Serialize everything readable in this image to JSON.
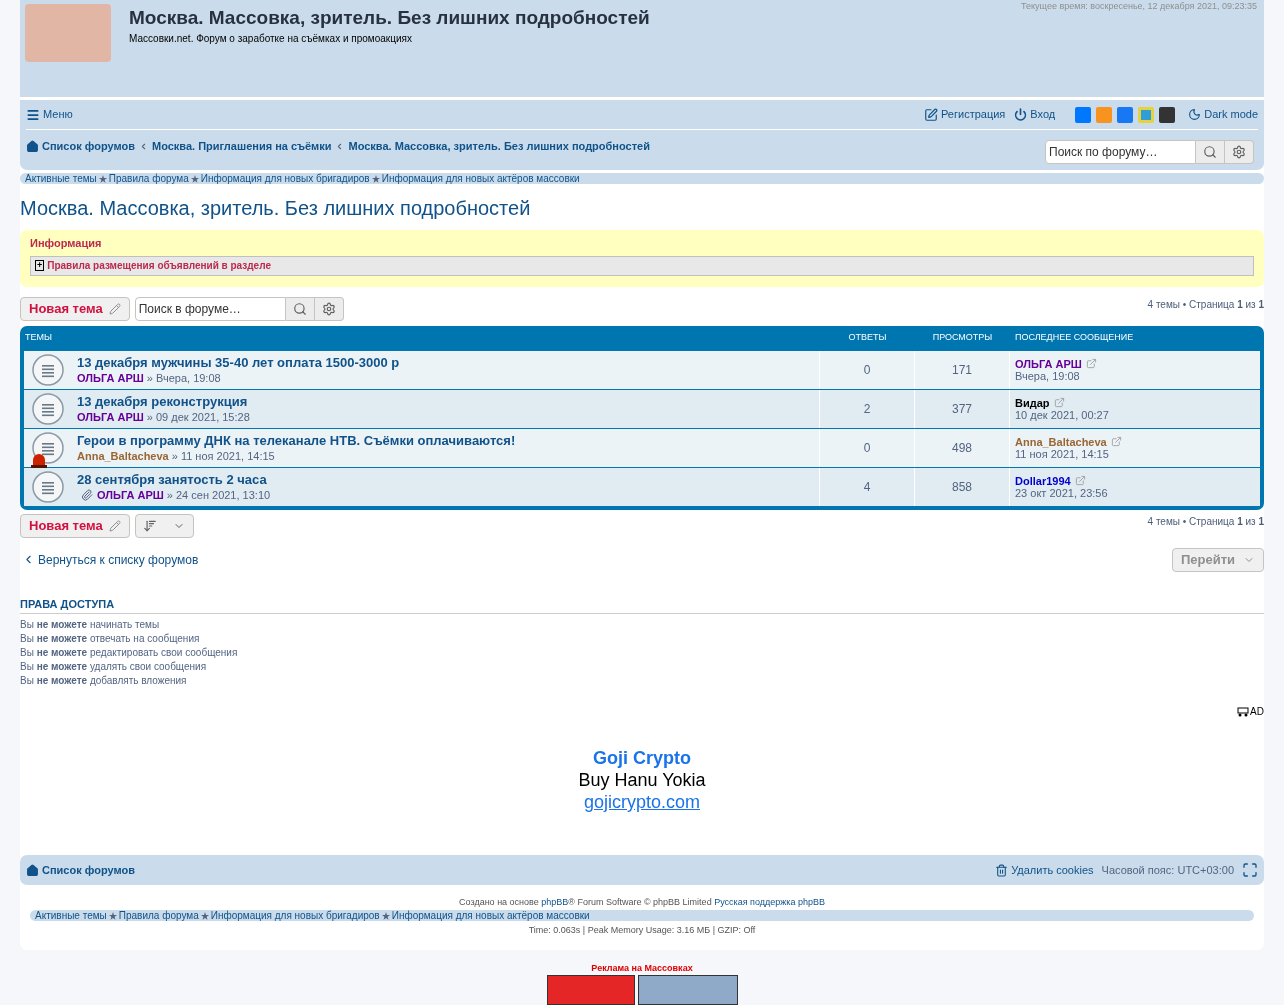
{
  "header": {
    "time": "Текущее время: воскресенье, 12 декабря 2021, 09:23:35",
    "title": "Москва. Массовка, зритель. Без лишних подробностей",
    "subtitle": "Массовки.net. Форум о заработке на съёмках и промоакциях"
  },
  "navbar": {
    "menu": "Меню",
    "register": "Регистрация",
    "login": "Вход",
    "dark_mode": "Dark mode"
  },
  "breadcrumbs": [
    "Список форумов",
    "Москва. Приглашения на съёмки",
    "Москва. Массовка, зритель. Без лишних подробностей"
  ],
  "search": {
    "placeholder": "Поиск по форуму…"
  },
  "quicklinks": [
    "Активные темы",
    "Правила форума",
    "Информация для новых бригадиров",
    "Информация для новых актёров массовки"
  ],
  "page_title": "Москва. Массовка, зритель. Без лишних подробностей",
  "info": {
    "title": "Информация",
    "toggle": "+",
    "rule": "Правила размещения объявлений в разделе"
  },
  "toolbar": {
    "new_topic": "Новая тема",
    "search_placeholder": "Поиск в форуме…",
    "pagination": "4 темы • Страница **1** из **1**"
  },
  "table": {
    "columns": [
      "ТЕМЫ",
      "ОТВЕТЫ",
      "ПРОСМОТРЫ",
      "ПОСЛЕДНЕЕ СООБЩЕНИЕ"
    ],
    "rows": [
      {
        "title": "13 декабря мужчины 35-40 лет оплата 1500-3000 р",
        "author": {
          "name": "ОЛЬГА АРШ",
          "color": "#660099"
        },
        "date": "» Вчера, 19:08",
        "hot": false,
        "attachment": false,
        "replies": "0",
        "views": "171",
        "last_author": {
          "name": "ОЛЬГА АРШ",
          "color": "#660099"
        },
        "last_date": "Вчера, 19:08"
      },
      {
        "title": "13 декабря реконструкция",
        "author": {
          "name": "ОЛЬГА АРШ",
          "color": "#660099"
        },
        "date": "» 09 дек 2021, 15:28",
        "hot": false,
        "attachment": false,
        "replies": "2",
        "views": "377",
        "last_author": {
          "name": "Видар",
          "color": "#000000"
        },
        "last_date": "10 дек 2021, 00:27"
      },
      {
        "title": "Герои в программу ДНК на телеканале НТВ. Съёмки оплачиваются!",
        "author": {
          "name": "Anna_Baltacheva",
          "color": "#996633"
        },
        "date": "» 11 ноя 2021, 14:15",
        "hot": true,
        "attachment": false,
        "replies": "0",
        "views": "498",
        "last_author": {
          "name": "Anna_Baltacheva",
          "color": "#996633"
        },
        "last_date": "11 ноя 2021, 14:15"
      },
      {
        "title": "28 сентября занятость 2 часа",
        "author": {
          "name": "ОЛЬГА АРШ",
          "color": "#660099"
        },
        "date": "» 24 сен 2021, 13:10",
        "hot": false,
        "attachment": true,
        "replies": "4",
        "views": "858",
        "last_author": {
          "name": "Dollar1994",
          "color": "#0000cc"
        },
        "last_date": "23 окт 2021, 23:56"
      }
    ]
  },
  "bottom_toolbar": {
    "new_topic": "Новая тема",
    "pagination": "4 темы • Страница **1** из **1**"
  },
  "back_link": "Вернуться к списку форумов",
  "jump_button": "Перейти",
  "permissions": {
    "title": "ПРАВА ДОСТУПА",
    "lines": [
      "Вы **не можете** начинать темы",
      "Вы **не можете** отвечать на сообщения",
      "Вы **не можете** редактировать свои сообщения",
      "Вы **не можете** удалять свои сообщения",
      "Вы **не можете** добавлять вложения"
    ]
  },
  "ad": {
    "label": "AD",
    "title": "Goji Crypto",
    "text": "Buy Hanu Yokia",
    "link": "gojicrypto.com"
  },
  "footer_nav": {
    "home": "Список форумов",
    "delete_cookies": "Удалить cookies",
    "timezone": "Часовой пояс: ",
    "timezone_value": "UTC+03:00"
  },
  "credits": {
    "prefix": "Создано на основе ",
    "link": "phpBB",
    "middle": "® Forum Software © phpBB Limited ",
    "support": "Русская поддержка phpBB"
  },
  "footer_quicklinks": [
    "Активные темы",
    "Правила форума",
    "Информация для новых бригадиров",
    "Информация для новых актёров массовки"
  ],
  "stats": "Time: 0.063s | Peak Memory Usage: 3.16 МБ | GZIP: Off",
  "ads_label": "Реклама на Массовках"
}
